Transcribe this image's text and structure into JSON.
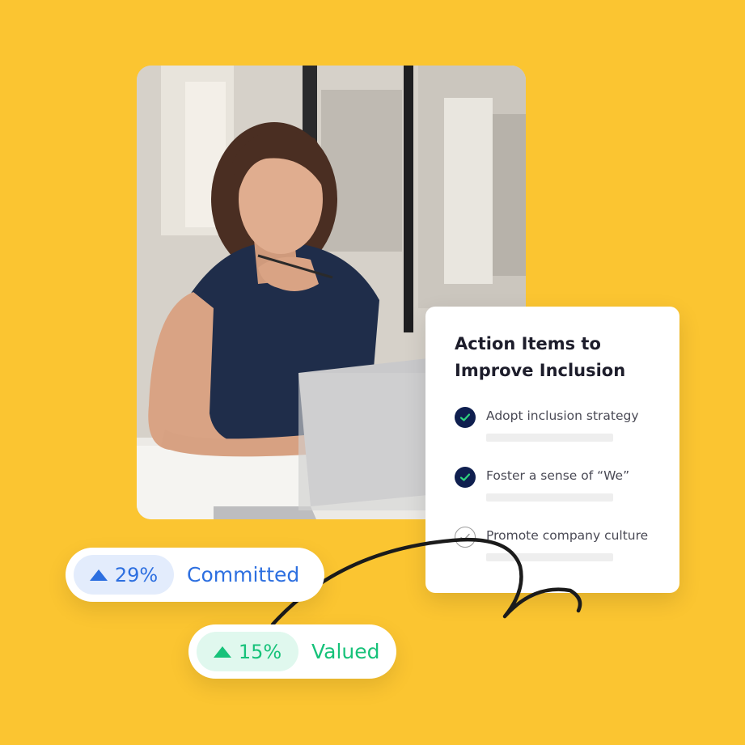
{
  "card": {
    "title": "Action Items to Improve Inclusion",
    "items": [
      {
        "label": "Adopt inclusion strategy",
        "checked": true
      },
      {
        "label": "Foster a sense of “We”",
        "checked": true
      },
      {
        "label": "Promote company culture",
        "checked": false
      }
    ]
  },
  "stats": {
    "committed": {
      "value": "29%",
      "label": "Committed",
      "direction": "up",
      "color": "#2D6FE0"
    },
    "valued": {
      "value": "15%",
      "label": "Valued",
      "direction": "up",
      "color": "#17C27A"
    }
  },
  "colors": {
    "background": "#FBC531",
    "check_fill": "#0F1F4F",
    "check_mark": "#2FD47E"
  }
}
